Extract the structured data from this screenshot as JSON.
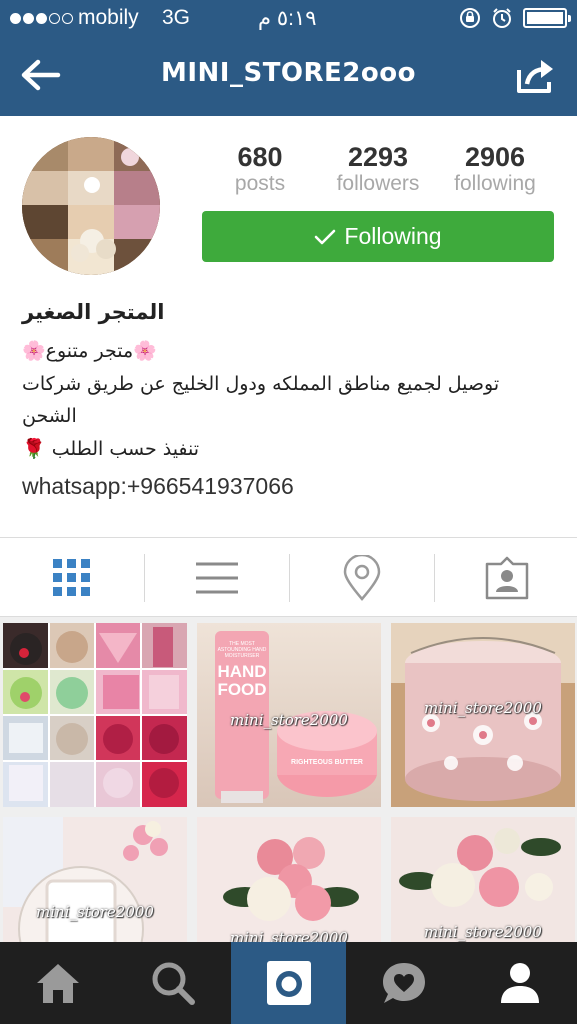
{
  "status_bar": {
    "signal_dots_filled": 3,
    "signal_dots_total": 5,
    "carrier": "mobily",
    "network": "3G",
    "time": "٥:١٩ م",
    "icons": [
      "orientation-lock-icon",
      "alarm-icon",
      "battery-icon"
    ]
  },
  "nav": {
    "title": "MINI_STORE2ooo",
    "back_icon": "arrow-left-icon",
    "share_icon": "share-icon"
  },
  "profile": {
    "stats": [
      {
        "value": "680",
        "label": "posts"
      },
      {
        "value": "2293",
        "label": "followers"
      },
      {
        "value": "2906",
        "label": "following"
      }
    ],
    "follow_button": "Following",
    "follow_icon": "checkmark-icon",
    "button_color": "#3eaa3c"
  },
  "bio": {
    "name": "المتجر الصغير",
    "line1": "🌸متجر متنوع🌸",
    "line2": "توصيل لجميع مناطق المملكه ودول الخليج عن طريق شركات الشحن",
    "line3": "تنفيذ حسب الطلب 🌹",
    "contact": "whatsapp:+966541937066"
  },
  "view_tabs": [
    {
      "name": "grid-view-tab",
      "icon": "grid-icon",
      "active": true
    },
    {
      "name": "list-view-tab",
      "icon": "list-icon",
      "active": false
    },
    {
      "name": "map-view-tab",
      "icon": "location-pin-icon",
      "active": false
    },
    {
      "name": "tagged-view-tab",
      "icon": "tagged-person-icon",
      "active": false
    }
  ],
  "photos": [
    {
      "watermark": ""
    },
    {
      "watermark": "mini_store2000"
    },
    {
      "watermark": "mini_store2000"
    },
    {
      "watermark": "mini_store2000"
    },
    {
      "watermark": "mini_store2000"
    },
    {
      "watermark": "mini_store2000"
    }
  ],
  "product_text": {
    "hand_food_top": "THE MOST ASTOUNDING HAND MOISTURISER",
    "hand_food": "HAND FOOD",
    "butter": "RIGHTEOUS BUTTER"
  },
  "tab_bar": [
    {
      "name": "home-tab",
      "icon": "home-icon",
      "active": false
    },
    {
      "name": "explore-tab",
      "icon": "search-icon",
      "active": false
    },
    {
      "name": "camera-tab",
      "icon": "camera-icon",
      "active": true
    },
    {
      "name": "activity-tab",
      "icon": "heart-bubble-icon",
      "active": false
    },
    {
      "name": "profile-tab",
      "icon": "person-icon",
      "active": false
    }
  ],
  "colors": {
    "header_blue": "#2c5a85",
    "tab_bar_dark": "#1f1f1f",
    "active_tab_blue": "#2c5a85",
    "accent_blue": "#3b82c4"
  }
}
